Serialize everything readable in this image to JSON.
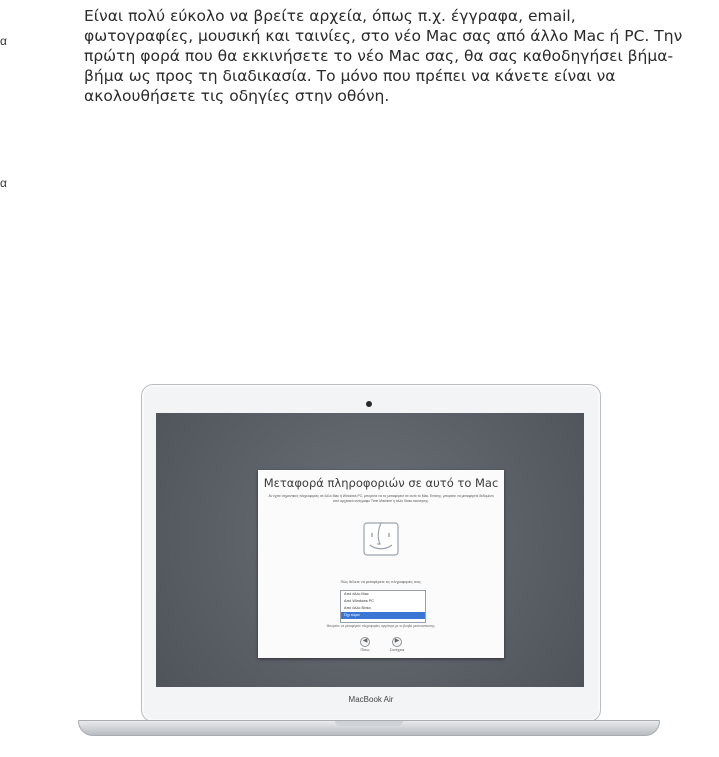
{
  "margin_marks": [
    "α",
    "α"
  ],
  "intro_text": "Είναι πολύ εύκολο να βρείτε αρχεία, όπως π.χ. έγγραφα, email, φωτογραφίες, μουσική και ταινίες, στο νέο Mac σας από άλλο Mac ή PC. Την πρώτη φορά που θα εκκινήσετε το νέο Mac σας, θα σας καθοδηγήσει βήμα-βήμα ως προς τη διαδικασία. Το μόνο που πρέπει να κάνετε είναι να ακολουθήσετε τις οδηγίες στην οθόνη.",
  "laptop": {
    "brand": "MacBook Air",
    "dialog": {
      "title": "Μεταφορά πληροφοριών σε αυτό το Mac",
      "description": "Αν έχετε σημαντικές πληροφορίες σε άλλο Mac ή Windows PC, μπορείτε να τις μεταφέρετε σε αυτό το Mac. Επίσης, μπορείτε να μεταφέρετε δεδομένα από αρχειακό αντίγραφο Time Machine ή άλλο δίσκο εκκίνησης.",
      "finder_icon": "finder-icon",
      "question": "Πώς θέλετε να μεταφέρετε τις πληροφορίες σας;",
      "options": [
        {
          "label": "Από άλλο Mac",
          "selected": false
        },
        {
          "label": "Από Windows PC",
          "selected": false
        },
        {
          "label": "Από άλλο δίσκο",
          "selected": false
        },
        {
          "label": "Όχι τώρα",
          "selected": true
        }
      ],
      "note": "Μπορείτε να μεταφέρετε πληροφορίες αργότερα με το βοηθό μεταναστευσης.",
      "back_label": "Πίσω",
      "back_glyph": "◀",
      "continue_label": "Συνέχεια",
      "continue_glyph": "▶",
      "accent_color": "#3a77d5"
    }
  }
}
